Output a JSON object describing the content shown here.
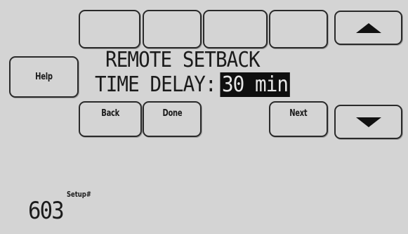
{
  "top_row": {
    "blank_buttons": [
      "",
      "",
      "",
      ""
    ]
  },
  "help": {
    "label": "Help"
  },
  "display": {
    "line1": "REMOTE SETBACK",
    "line2_label": "TIME DELAY:",
    "value": "30 min"
  },
  "nav": {
    "back_label": "Back",
    "done_label": "Done",
    "next_label": "Next"
  },
  "arrows": {
    "up_icon": "triangle-up",
    "down_icon": "triangle-down"
  },
  "setup": {
    "label": "Setup#",
    "number": "603"
  }
}
